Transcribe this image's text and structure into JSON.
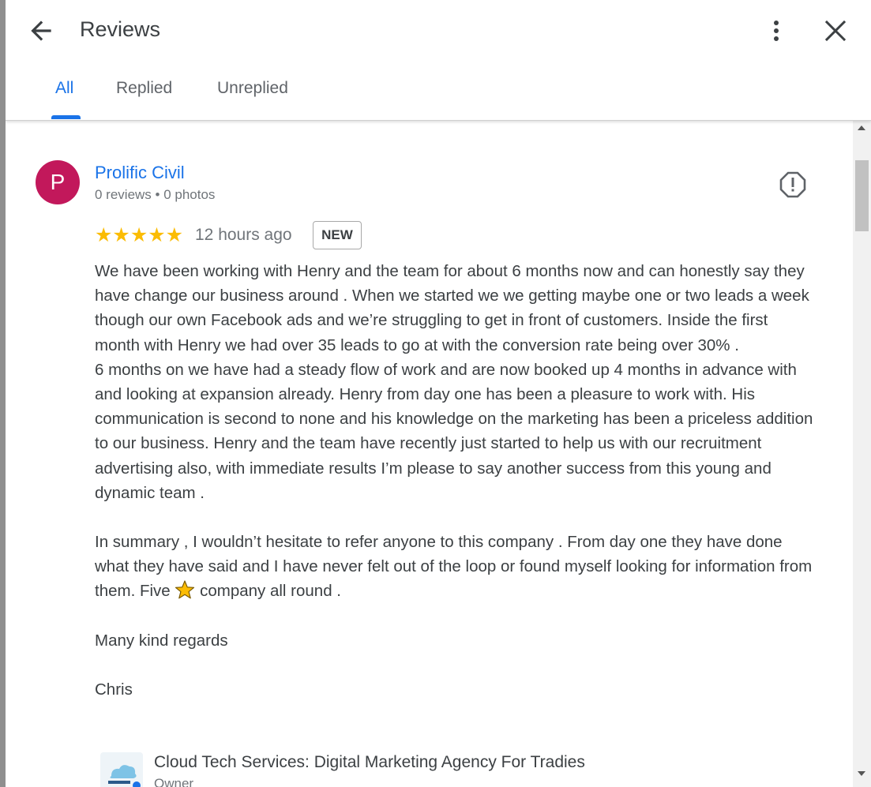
{
  "header": {
    "title": "Reviews",
    "back_icon": "arrow-left-icon",
    "more_icon": "more-vert-icon",
    "close_icon": "close-icon"
  },
  "tabs": [
    {
      "label": "All",
      "active": true
    },
    {
      "label": "Replied",
      "active": false
    },
    {
      "label": "Unreplied",
      "active": false
    }
  ],
  "review": {
    "avatar_letter": "P",
    "avatar_color": "#c2185b",
    "reviewer_name": "Prolific Civil",
    "reviewer_meta": "0 reviews • 0 photos",
    "report_icon": "report-icon",
    "rating": 5,
    "stars_text": "★★★★★",
    "time_ago": "12 hours ago",
    "badge": "NEW",
    "paragraph_1": "We have been working with Henry and the team for about 6 months now and can honestly say they have change our business around . When we started we we getting maybe one or two leads a week though our own Facebook ads and we’re struggling to get in front of customers. Inside the first month with Henry we had over 35 leads to go at with the conversion rate being over 30% .",
    "paragraph_2": "6 months on we have had a steady flow of work and are now booked up 4 months in advance with and looking at expansion already. Henry from day one has been a pleasure to work with. His communication is second to none and his knowledge on the marketing has been a priceless addition to our business. Henry and the team have recently just started to help us with our recruitment advertising also, with immediate results I’m please to say another success from this young and dynamic team .",
    "paragraph_3_before": "In summary , I wouldn’t hesitate to refer anyone to this company . From day one they have done what they have said and I have never felt out of the loop or found myself looking for information from them. Five ",
    "paragraph_3_after": " company all round .",
    "paragraph_4": "Many kind regards",
    "paragraph_5": "Chris"
  },
  "owner_reply": {
    "name": "Cloud Tech Services: Digital Marketing Agency For Tradies",
    "role": "Owner"
  },
  "colors": {
    "accent": "#1a73e8",
    "star": "#fbbc04",
    "text": "#3c4043",
    "secondary_text": "#70757a"
  }
}
